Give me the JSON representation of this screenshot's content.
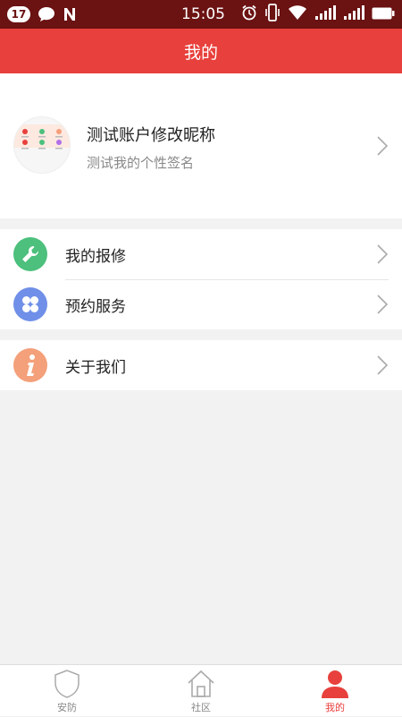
{
  "status_bar": {
    "notification_count": "17",
    "time": "15:05",
    "icons": [
      "chat-bubble-icon",
      "n-app-icon",
      "alarm-icon",
      "vibrate-icon",
      "wifi-icon",
      "signal-icon",
      "signal-icon",
      "battery-icon"
    ]
  },
  "header": {
    "title": "我的"
  },
  "profile": {
    "name": "测试账户修改昵称",
    "signature": "测试我的个性签名"
  },
  "menu": {
    "group1": [
      {
        "label": "我的报修",
        "icon": "wrench-icon",
        "color": "#4cc07c"
      },
      {
        "label": "预约服务",
        "icon": "clover-icon",
        "color": "#6f8fe8"
      }
    ],
    "group2": [
      {
        "label": "关于我们",
        "icon": "info-icon",
        "color": "#f4a07a"
      }
    ]
  },
  "tabbar": {
    "tabs": [
      {
        "label": "安防",
        "icon": "shield-icon"
      },
      {
        "label": "社区",
        "icon": "home-icon"
      },
      {
        "label": "我的",
        "icon": "person-icon",
        "active": true
      }
    ],
    "active_color": "#e8403c"
  },
  "colors": {
    "status_bar": "#6b1212",
    "header": "#e8403c",
    "background": "#f2f2f2"
  }
}
